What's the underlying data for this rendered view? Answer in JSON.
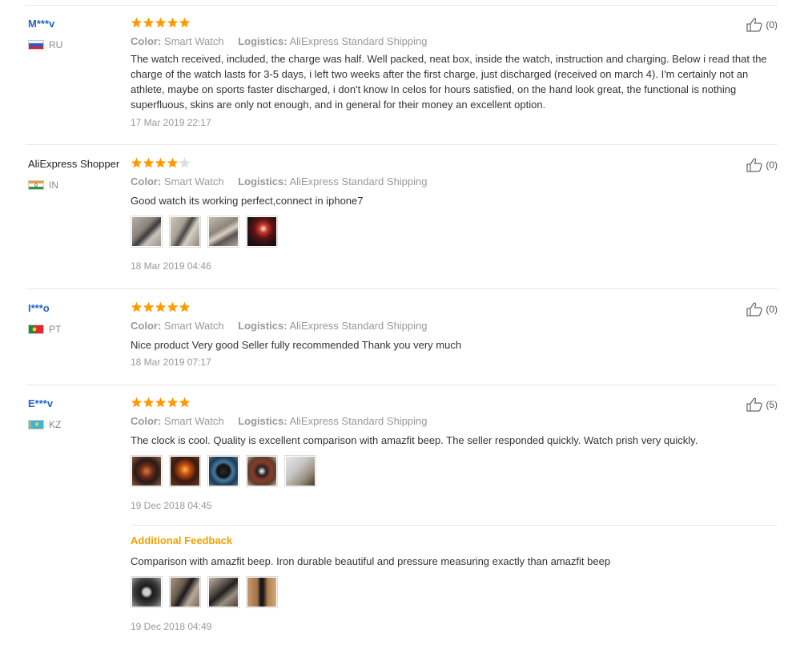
{
  "reviews": [
    {
      "user": "M***v",
      "country": "RU",
      "stars": 5,
      "color_label": "Color:",
      "color_value": "Smart Watch",
      "logistics_label": "Logistics:",
      "logistics_value": "AliExpress Standard Shipping",
      "text": "The watch received, included, the charge was half. Well packed, neat box, inside the watch, instruction and charging. Below i read that the charge of the watch lasts for 3-5 days, i left two weeks after the first charge, just discharged (received on march 4). I'm certainly not an athlete, maybe on sports faster discharged, i don't know In celos for hours satisfied, on the hand look great, the functional is nothing superfluous, skins are only not enough, and in general for their money an excellent option.",
      "date": "17 Mar 2019 22:17",
      "helpful": "(0)"
    },
    {
      "user": "AliExpress Shopper",
      "country": "IN",
      "stars": 4,
      "color_label": "Color:",
      "color_value": "Smart Watch",
      "logistics_label": "Logistics:",
      "logistics_value": "AliExpress Standard Shipping",
      "text": "Good watch its working perfect,connect in iphone7",
      "date": "18 Mar 2019 04:46",
      "helpful": "(0)"
    },
    {
      "user": "I***o",
      "country": "PT",
      "stars": 5,
      "color_label": "Color:",
      "color_value": "Smart Watch",
      "logistics_label": "Logistics:",
      "logistics_value": "AliExpress Standard Shipping",
      "text": "Nice product Very good Seller fully recommended Thank you very much",
      "date": "18 Mar 2019 07:17",
      "helpful": "(0)"
    },
    {
      "user": "E***v",
      "country": "KZ",
      "stars": 5,
      "color_label": "Color:",
      "color_value": "Smart Watch",
      "logistics_label": "Logistics:",
      "logistics_value": "AliExpress Standard Shipping",
      "text": "The clock is cool. Quality is excellent comparison with amazfit beep. The seller responded quickly. Watch prish very quickly.",
      "date": "19 Dec 2018 04:45",
      "helpful": "(5)",
      "additional_feedback": {
        "title": "Additional Feedback",
        "text": "Comparison with amazfit beep. Iron durable beautiful and pressure measuring exactly than amazfit beep",
        "date": "19 Dec 2018 04:49"
      }
    }
  ],
  "colors": {
    "star": "#ff9a00",
    "star_empty": "#dddddd",
    "username_link": "#2264c8",
    "additional_feedback": "#f5a000"
  }
}
